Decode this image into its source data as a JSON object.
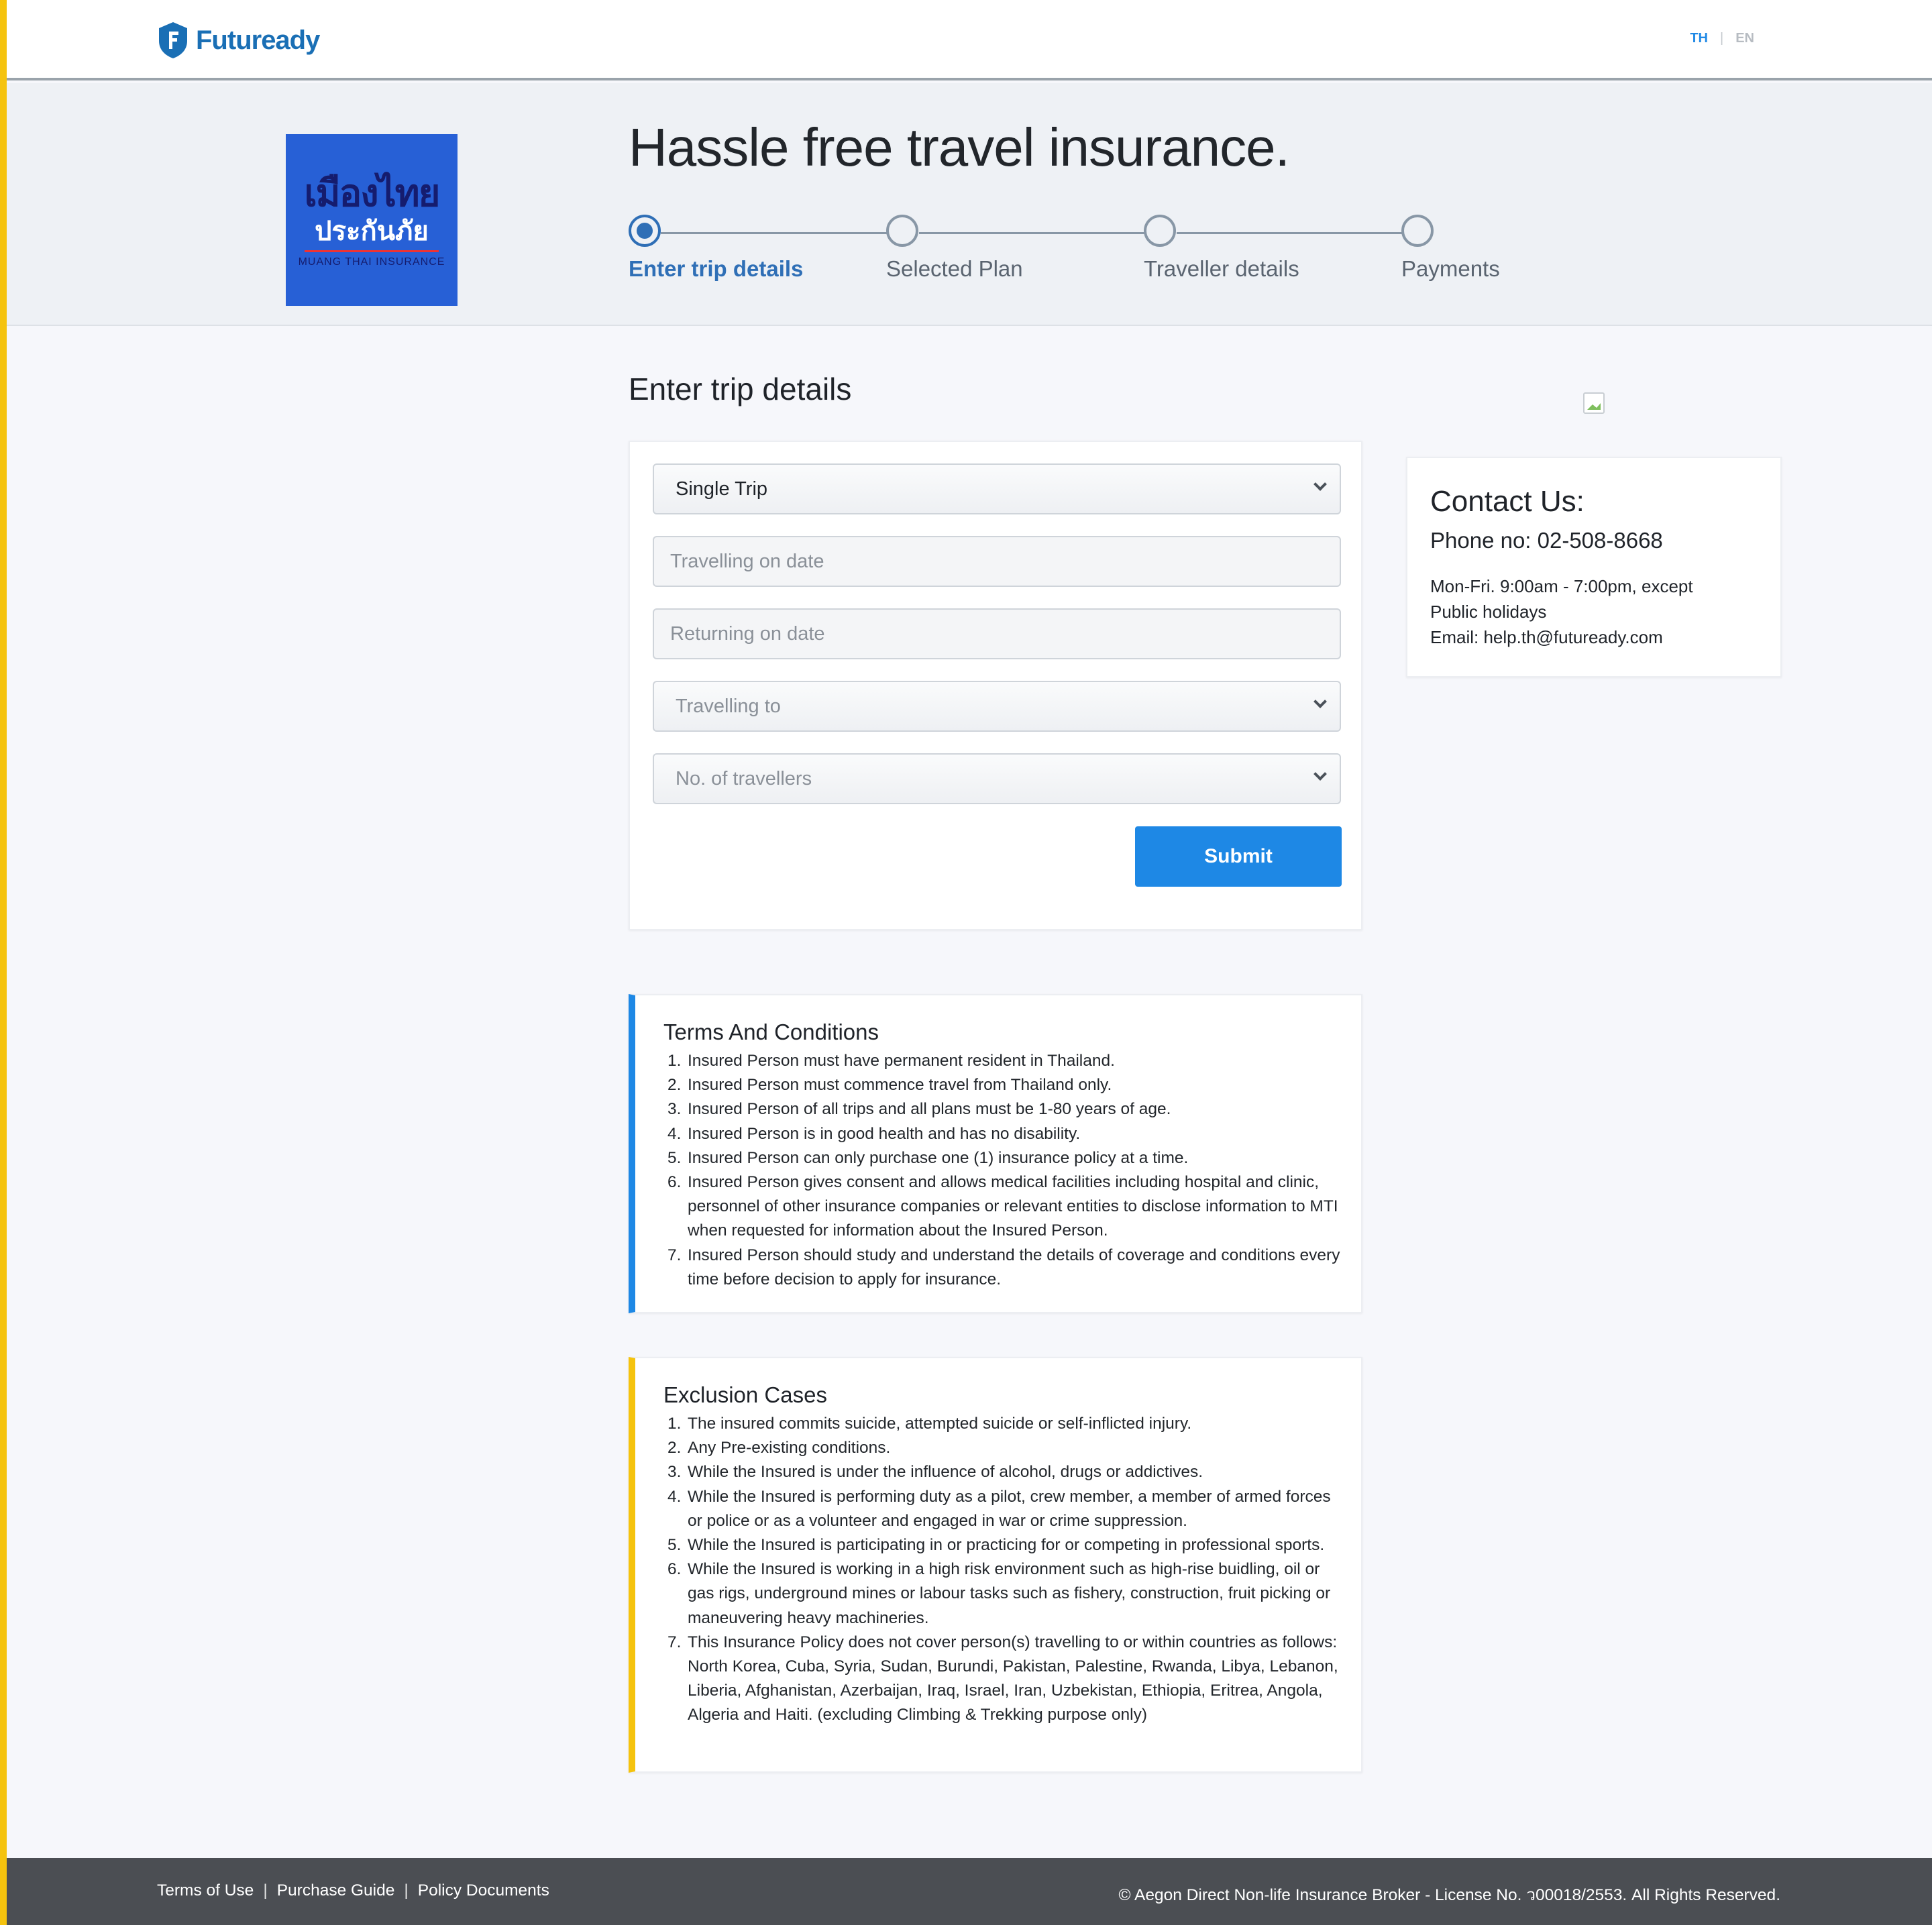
{
  "header": {
    "brand": "Futuready",
    "lang_th": "TH",
    "lang_sep": "|",
    "lang_en": "EN"
  },
  "hero": {
    "partner_logo": {
      "line1": "เมืองไทย",
      "line2": "ประกันภัย",
      "line3": "MUANG THAI INSURANCE"
    },
    "title": "Hassle free travel insurance.",
    "steps": [
      {
        "label": "Enter trip details",
        "active": true
      },
      {
        "label": "Selected Plan",
        "active": false
      },
      {
        "label": "Traveller details",
        "active": false
      },
      {
        "label": "Payments",
        "active": false
      }
    ]
  },
  "main": {
    "section_title": "Enter trip details",
    "form": {
      "trip_type": {
        "value": "Single Trip"
      },
      "travelling_on": {
        "placeholder": "Travelling on date"
      },
      "returning_on": {
        "placeholder": "Returning on date"
      },
      "travelling_to": {
        "value": "Travelling to"
      },
      "no_of_travellers": {
        "value": "No. of travellers"
      },
      "submit_label": "Submit"
    }
  },
  "contact": {
    "title": "Contact Us:",
    "phone": "Phone no: 02-508-8668",
    "hours": "Mon-Fri. 9:00am - 7:00pm, except Public holidays",
    "email": "Email: help.th@futuready.com"
  },
  "terms": {
    "title": "Terms And Conditions",
    "items": [
      "Insured Person must have permanent resident in Thailand.",
      "Insured Person must commence travel from Thailand only.",
      "Insured Person of all trips and all plans must be 1-80 years of age.",
      "Insured Person is in good health and has no disability.",
      "Insured Person can only purchase one (1) insurance policy at a time.",
      "Insured Person gives consent and allows medical facilities including hospital and clinic, personnel of other insurance companies or relevant entities to disclose information to MTI when requested for information about the Insured Person.",
      "Insured Person should study and understand the details of coverage and conditions every time before decision to apply for insurance."
    ]
  },
  "exclusions": {
    "title": "Exclusion Cases",
    "items": [
      "The insured commits suicide, attempted suicide or self-inflicted injury.",
      "Any Pre-existing conditions.",
      "While the Insured is under the influence of alcohol, drugs or addictives.",
      "While the Insured is performing duty as a pilot, crew member, a member of armed forces or police or as a volunteer and engaged in war or crime suppression.",
      "While the Insured is participating in or practicing for or competing in professional sports.",
      "While the Insured is working in a high risk environment such as high-rise buidling, oil or gas rigs, underground mines or labour tasks such as fishery, construction, fruit picking or maneuvering heavy machineries.",
      "This Insurance Policy does not cover person(s) travelling to or within countries as follows: North Korea, Cuba, Syria, Sudan, Burundi, Pakistan, Palestine, Rwanda, Libya, Lebanon, Liberia, Afghanistan, Azerbaijan, Iraq, Israel, Iran, Uzbekistan, Ethiopia, Eritrea, Angola, Algeria and Haiti. (excluding Climbing & Trekking purpose only)"
    ]
  },
  "footer": {
    "links": [
      "Terms of Use",
      "Purchase Guide",
      "Policy Documents"
    ],
    "separator": "|",
    "copyright": "© Aegon Direct Non-life Insurance Broker - License No. ว00018/2553.  All Rights Reserved."
  }
}
